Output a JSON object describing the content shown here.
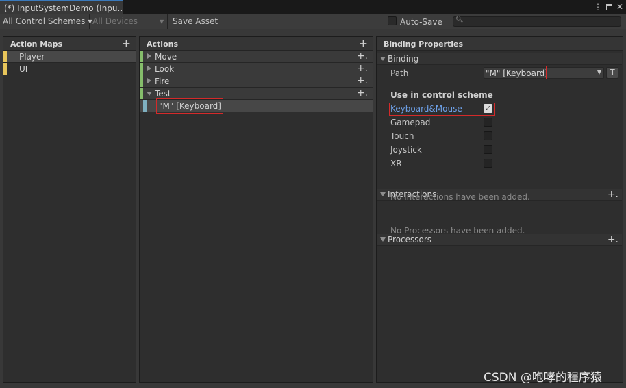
{
  "window": {
    "tab_title": "(*) InputSystemDemo (Inpu..."
  },
  "toolbar": {
    "control_schemes": "All Control Schemes",
    "devices": "All Devices",
    "save_asset": "Save Asset",
    "auto_save": "Auto-Save",
    "search_placeholder": ""
  },
  "action_maps": {
    "title": "Action Maps",
    "items": [
      {
        "label": "Player",
        "selected": true
      },
      {
        "label": "UI",
        "selected": false
      }
    ]
  },
  "actions": {
    "title": "Actions",
    "items": [
      {
        "label": "Move"
      },
      {
        "label": "Look"
      },
      {
        "label": "Fire"
      },
      {
        "label": "Test",
        "expanded": true
      }
    ],
    "binding": "\"M\" [Keyboard]"
  },
  "binding_properties": {
    "title": "Binding Properties",
    "binding_section": "Binding",
    "path_label": "Path",
    "path_value": "\"M\" [Keyboard]",
    "t_button": "T",
    "use_in_scheme": "Use in control scheme",
    "schemes": [
      {
        "label": "Keyboard&Mouse",
        "checked": true
      },
      {
        "label": "Gamepad",
        "checked": false
      },
      {
        "label": "Touch",
        "checked": false
      },
      {
        "label": "Joystick",
        "checked": false
      },
      {
        "label": "XR",
        "checked": false
      }
    ],
    "interactions_title": "Interactions",
    "interactions_empty": "No Interactions have been added.",
    "processors_title": "Processors",
    "processors_empty": "No Processors have been added."
  },
  "watermark": "CSDN @咆哮的程序猿",
  "colors": {
    "map_bar": "#e8c55a",
    "action_bar": "#85bd6b",
    "binding_bar": "#7fb0c0",
    "highlight_red": "#d42a2a",
    "link_blue": "#6d9fe6",
    "tab_accent": "#3a79bb"
  }
}
